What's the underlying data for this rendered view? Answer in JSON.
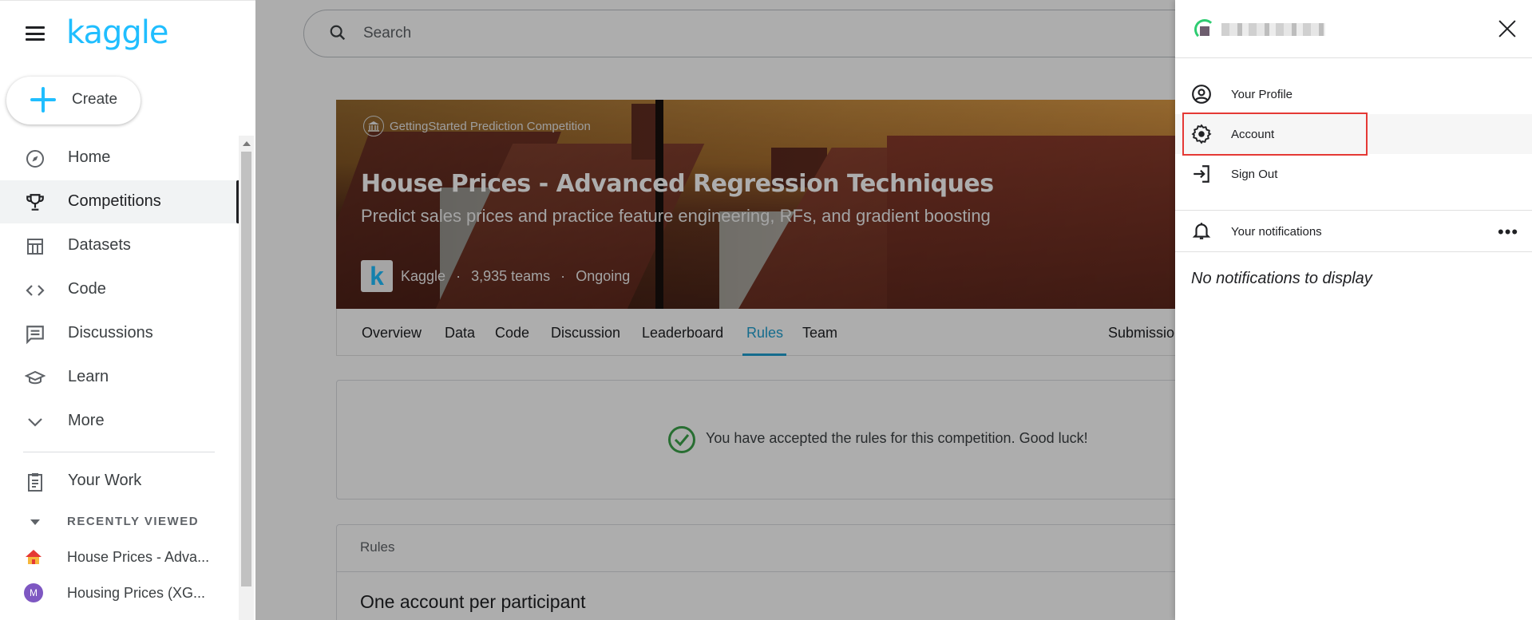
{
  "brand": {
    "logo_text": "kaggle",
    "accent": "#20beff"
  },
  "sidebar": {
    "create_label": "Create",
    "items": [
      {
        "label": "Home",
        "icon": "compass-icon"
      },
      {
        "label": "Competitions",
        "icon": "trophy-icon",
        "active": true
      },
      {
        "label": "Datasets",
        "icon": "table-icon"
      },
      {
        "label": "Code",
        "icon": "code-brackets-icon"
      },
      {
        "label": "Discussions",
        "icon": "chat-icon"
      },
      {
        "label": "Learn",
        "icon": "graduation-cap-icon"
      },
      {
        "label": "More",
        "icon": "chevron-down-icon"
      }
    ],
    "your_work_label": "Your Work",
    "recently_viewed_label": "RECENTLY VIEWED",
    "recent_items": [
      {
        "label": "House Prices - Adva...",
        "icon": "house-thumbnail-icon"
      },
      {
        "label": "Housing Prices (XG...",
        "icon": "avatar-m-icon",
        "avatar_letter": "M"
      }
    ]
  },
  "search": {
    "placeholder": "Search"
  },
  "competition": {
    "type_label": "GettingStarted Prediction Competition",
    "title": "House Prices - Advanced Regression Techniques",
    "subtitle": "Predict sales prices and practice feature engineering, RFs, and gradient boosting",
    "host": "Kaggle",
    "host_logo_letter": "k",
    "teams": "3,935 teams",
    "status": "Ongoing",
    "separator": "·"
  },
  "tabs": [
    {
      "label": "Overview"
    },
    {
      "label": "Data"
    },
    {
      "label": "Code"
    },
    {
      "label": "Discussion"
    },
    {
      "label": "Leaderboard"
    },
    {
      "label": "Rules",
      "active": true
    },
    {
      "label": "Team"
    },
    {
      "label": "Submissio"
    }
  ],
  "accepted_message": "You have accepted the rules for this competition. Good luck!",
  "rules": {
    "header": "Rules",
    "first_rule_title": "One account per participant"
  },
  "drawer": {
    "menu": [
      {
        "label": "Your Profile",
        "icon": "user-circle-icon"
      },
      {
        "label": "Account",
        "icon": "gear-icon",
        "highlighted": true
      },
      {
        "label": "Sign Out",
        "icon": "sign-out-icon"
      }
    ],
    "notifications_label": "Your notifications",
    "no_notifications": "No notifications to display"
  },
  "colors": {
    "tab_active": "#20a0d0",
    "check_green": "#3ba34a",
    "highlight_red": "#e53935"
  }
}
